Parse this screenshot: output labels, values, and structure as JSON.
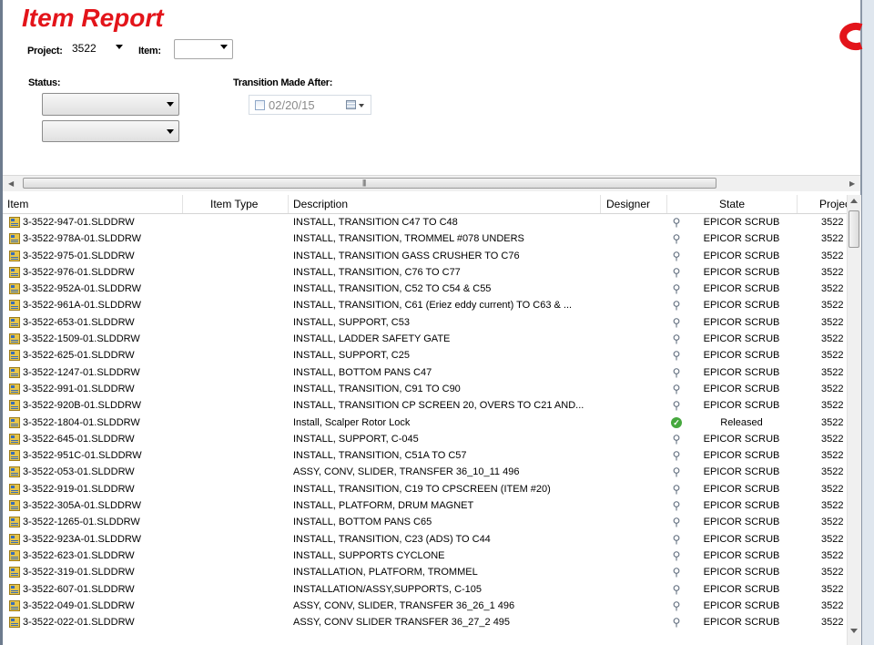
{
  "report": {
    "title": "Item Report"
  },
  "filters": {
    "project_label": "Project:",
    "project_value": "3522",
    "item_label": "Item:",
    "item_value": "",
    "status_label": "Status:",
    "status_value_1": "",
    "status_value_2": "",
    "transition_label": "Transition Made After:",
    "transition_checked": false,
    "transition_date": "02/20/15"
  },
  "grid": {
    "columns": {
      "item": "Item",
      "item_type": "Item Type",
      "description": "Description",
      "designer": "Designer",
      "state": "State",
      "project": "Projec"
    },
    "rows": [
      {
        "item": "3-3522-947-01.SLDDRW",
        "item_type": "",
        "description": "INSTALL, TRANSITION C47 TO C48",
        "designer": "",
        "state": "EPICOR SCRUB",
        "state_icon": "magnifier-icon",
        "project": "3522"
      },
      {
        "item": "3-3522-978A-01.SLDDRW",
        "item_type": "",
        "description": "INSTALL, TRANSITION, TROMMEL #078 UNDERS",
        "designer": "",
        "state": "EPICOR SCRUB",
        "state_icon": "magnifier-icon",
        "project": "3522"
      },
      {
        "item": "3-3522-975-01.SLDDRW",
        "item_type": "",
        "description": "INSTALL, TRANSITION GASS CRUSHER TO C76",
        "designer": "",
        "state": "EPICOR SCRUB",
        "state_icon": "magnifier-icon",
        "project": "3522"
      },
      {
        "item": "3-3522-976-01.SLDDRW",
        "item_type": "",
        "description": "INSTALL, TRANSITION, C76 TO C77",
        "designer": "",
        "state": "EPICOR SCRUB",
        "state_icon": "magnifier-icon",
        "project": "3522"
      },
      {
        "item": "3-3522-952A-01.SLDDRW",
        "item_type": "",
        "description": "INSTALL, TRANSITION, C52 TO C54 & C55",
        "designer": "",
        "state": "EPICOR SCRUB",
        "state_icon": "magnifier-icon",
        "project": "3522"
      },
      {
        "item": "3-3522-961A-01.SLDDRW",
        "item_type": "",
        "description": "INSTALL, TRANSITION, C61 (Eriez eddy current) TO C63 & ...",
        "designer": "",
        "state": "EPICOR SCRUB",
        "state_icon": "magnifier-icon",
        "project": "3522"
      },
      {
        "item": "3-3522-653-01.SLDDRW",
        "item_type": "",
        "description": "INSTALL, SUPPORT, C53",
        "designer": "",
        "state": "EPICOR SCRUB",
        "state_icon": "magnifier-icon",
        "project": "3522"
      },
      {
        "item": "3-3522-1509-01.SLDDRW",
        "item_type": "",
        "description": "INSTALL, LADDER SAFETY GATE",
        "designer": "",
        "state": "EPICOR SCRUB",
        "state_icon": "magnifier-icon",
        "project": "3522"
      },
      {
        "item": "3-3522-625-01.SLDDRW",
        "item_type": "",
        "description": "INSTALL, SUPPORT, C25",
        "designer": "",
        "state": "EPICOR SCRUB",
        "state_icon": "magnifier-icon",
        "project": "3522"
      },
      {
        "item": "3-3522-1247-01.SLDDRW",
        "item_type": "",
        "description": "INSTALL, BOTTOM PANS C47",
        "designer": "",
        "state": "EPICOR SCRUB",
        "state_icon": "magnifier-icon",
        "project": "3522"
      },
      {
        "item": "3-3522-991-01.SLDDRW",
        "item_type": "",
        "description": "INSTALL, TRANSITION, C91 TO C90",
        "designer": "",
        "state": "EPICOR SCRUB",
        "state_icon": "magnifier-icon",
        "project": "3522"
      },
      {
        "item": "3-3522-920B-01.SLDDRW",
        "item_type": "",
        "description": "INSTALL, TRANSITION CP SCREEN 20, OVERS TO C21 AND...",
        "designer": "",
        "state": "EPICOR SCRUB",
        "state_icon": "magnifier-icon",
        "project": "3522"
      },
      {
        "item": "3-3522-1804-01.SLDDRW",
        "item_type": "",
        "description": "Install, Scalper Rotor Lock",
        "designer": "",
        "state": "Released",
        "state_icon": "check-circle-icon",
        "project": "3522"
      },
      {
        "item": "3-3522-645-01.SLDDRW",
        "item_type": "",
        "description": "INSTALL, SUPPORT, C-045",
        "designer": "",
        "state": "EPICOR SCRUB",
        "state_icon": "magnifier-icon",
        "project": "3522"
      },
      {
        "item": "3-3522-951C-01.SLDDRW",
        "item_type": "",
        "description": "INSTALL, TRANSITION, C51A TO C57",
        "designer": "",
        "state": "EPICOR SCRUB",
        "state_icon": "magnifier-icon",
        "project": "3522"
      },
      {
        "item": "3-3522-053-01.SLDDRW",
        "item_type": "",
        "description": "ASSY, CONV, SLIDER, TRANSFER 36_10_11 496",
        "designer": "",
        "state": "EPICOR SCRUB",
        "state_icon": "magnifier-icon",
        "project": "3522"
      },
      {
        "item": "3-3522-919-01.SLDDRW",
        "item_type": "",
        "description": "INSTALL, TRANSITION, C19 TO CPSCREEN (ITEM #20)",
        "designer": "",
        "state": "EPICOR SCRUB",
        "state_icon": "magnifier-icon",
        "project": "3522"
      },
      {
        "item": "3-3522-305A-01.SLDDRW",
        "item_type": "",
        "description": "INSTALL, PLATFORM, DRUM MAGNET",
        "designer": "",
        "state": "EPICOR SCRUB",
        "state_icon": "magnifier-icon",
        "project": "3522"
      },
      {
        "item": "3-3522-1265-01.SLDDRW",
        "item_type": "",
        "description": "INSTALL, BOTTOM PANS C65",
        "designer": "",
        "state": "EPICOR SCRUB",
        "state_icon": "magnifier-icon",
        "project": "3522"
      },
      {
        "item": "3-3522-923A-01.SLDDRW",
        "item_type": "",
        "description": "INSTALL, TRANSITION, C23 (ADS) TO C44",
        "designer": "",
        "state": "EPICOR SCRUB",
        "state_icon": "magnifier-icon",
        "project": "3522"
      },
      {
        "item": "3-3522-623-01.SLDDRW",
        "item_type": "",
        "description": "INSTALL, SUPPORTS CYCLONE",
        "designer": "",
        "state": "EPICOR SCRUB",
        "state_icon": "magnifier-icon",
        "project": "3522"
      },
      {
        "item": "3-3522-319-01.SLDDRW",
        "item_type": "",
        "description": "INSTALLATION, PLATFORM, TROMMEL",
        "designer": "",
        "state": "EPICOR SCRUB",
        "state_icon": "magnifier-icon",
        "project": "3522"
      },
      {
        "item": "3-3522-607-01.SLDDRW",
        "item_type": "",
        "description": "INSTALLATION/ASSY,SUPPORTS, C-105",
        "designer": "",
        "state": "EPICOR SCRUB",
        "state_icon": "magnifier-icon",
        "project": "3522"
      },
      {
        "item": "3-3522-049-01.SLDDRW",
        "item_type": "",
        "description": "ASSY, CONV, SLIDER, TRANSFER 36_26_1 496",
        "designer": "",
        "state": "EPICOR SCRUB",
        "state_icon": "magnifier-icon",
        "project": "3522"
      },
      {
        "item": "3-3522-022-01.SLDDRW",
        "item_type": "",
        "description": "ASSY, CONV SLIDER TRANSFER 36_27_2 495",
        "designer": "",
        "state": "EPICOR SCRUB",
        "state_icon": "magnifier-icon",
        "project": "3522"
      }
    ]
  },
  "colors": {
    "title_red": "#e3141a",
    "released_green": "#46a83e"
  }
}
